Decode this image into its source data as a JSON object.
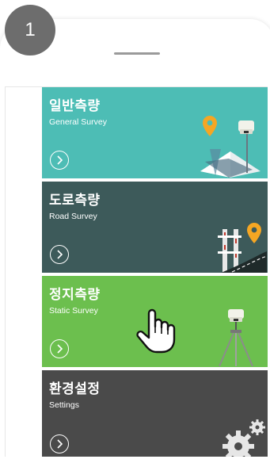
{
  "step": {
    "number": "1"
  },
  "menu": {
    "items": [
      {
        "title_ko": "일반측량",
        "title_en": "General Survey",
        "bg": "#4dbdb5",
        "icon": "gps-receiver-map-pin-icon"
      },
      {
        "title_ko": "도로측량",
        "title_en": "Road Survey",
        "bg": "#3d5a5a",
        "icon": "road-pin-icon"
      },
      {
        "title_ko": "정지측량",
        "title_en": "Static Survey",
        "bg": "#6cbf4e",
        "icon": "tripod-receiver-icon"
      },
      {
        "title_ko": "환경설정",
        "title_en": "Settings",
        "bg": "#4a4a4a",
        "icon": "gears-icon"
      }
    ]
  },
  "colors": {
    "badge": "#6d6d6d",
    "pin": "#f5a623"
  },
  "overlay": {
    "icon": "hand-pointer-icon"
  }
}
